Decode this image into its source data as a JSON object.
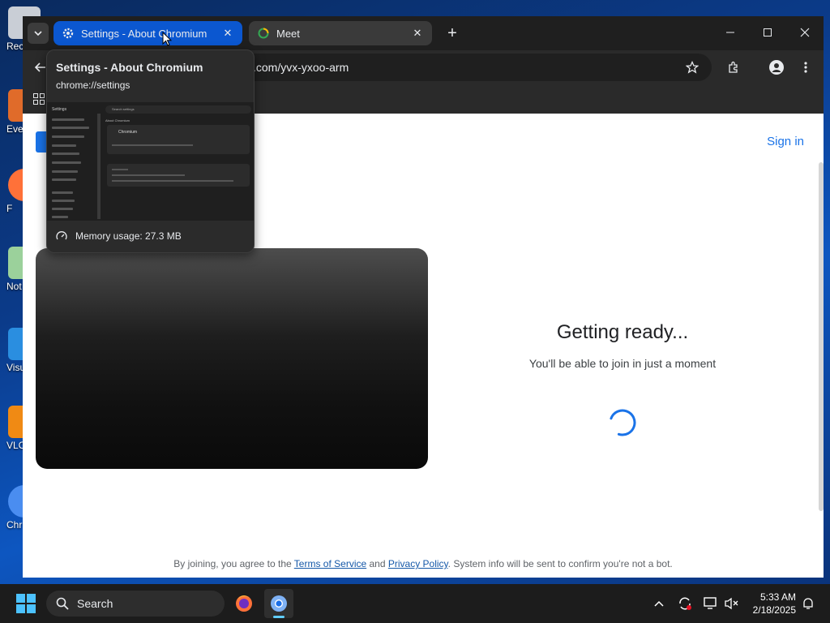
{
  "desktop": {
    "icons": [
      {
        "label": "Rec"
      },
      {
        "label": "Eve"
      },
      {
        "label": "F"
      },
      {
        "label": "Not"
      },
      {
        "label": "Visu"
      },
      {
        "label": "VLC"
      },
      {
        "label": "Chr"
      }
    ]
  },
  "tabs": [
    {
      "title": "Settings - About Chromium",
      "icon": "gear-icon",
      "active": true
    },
    {
      "title": "Meet",
      "icon": "meet-loading-icon",
      "active": false
    }
  ],
  "omnibox": {
    "url": ".com/yvx-yxoo-arm"
  },
  "hovercard": {
    "title": "Settings - About Chromium",
    "url": "chrome://settings",
    "memory": "Memory usage: 27.3 MB",
    "thumb": {
      "settings_label": "Settings",
      "search_label": "Search settings",
      "heading": "About Chromium",
      "card_name": "Chromium"
    }
  },
  "meet": {
    "sign_in": "Sign in",
    "ready_title": "Getting ready...",
    "ready_subtitle": "You'll be able to join in just a moment",
    "consent_prefix": "By joining, you agree to the ",
    "terms": "Terms of Service",
    "consent_and": " and ",
    "privacy": "Privacy Policy",
    "consent_suffix": ". System info will be sent to confirm you're not a bot."
  },
  "taskbar": {
    "search_placeholder": "Search",
    "time": "5:33 AM",
    "date": "2/18/2025"
  },
  "colors": {
    "accent": "#0b57d0",
    "link": "#1a73e8"
  }
}
